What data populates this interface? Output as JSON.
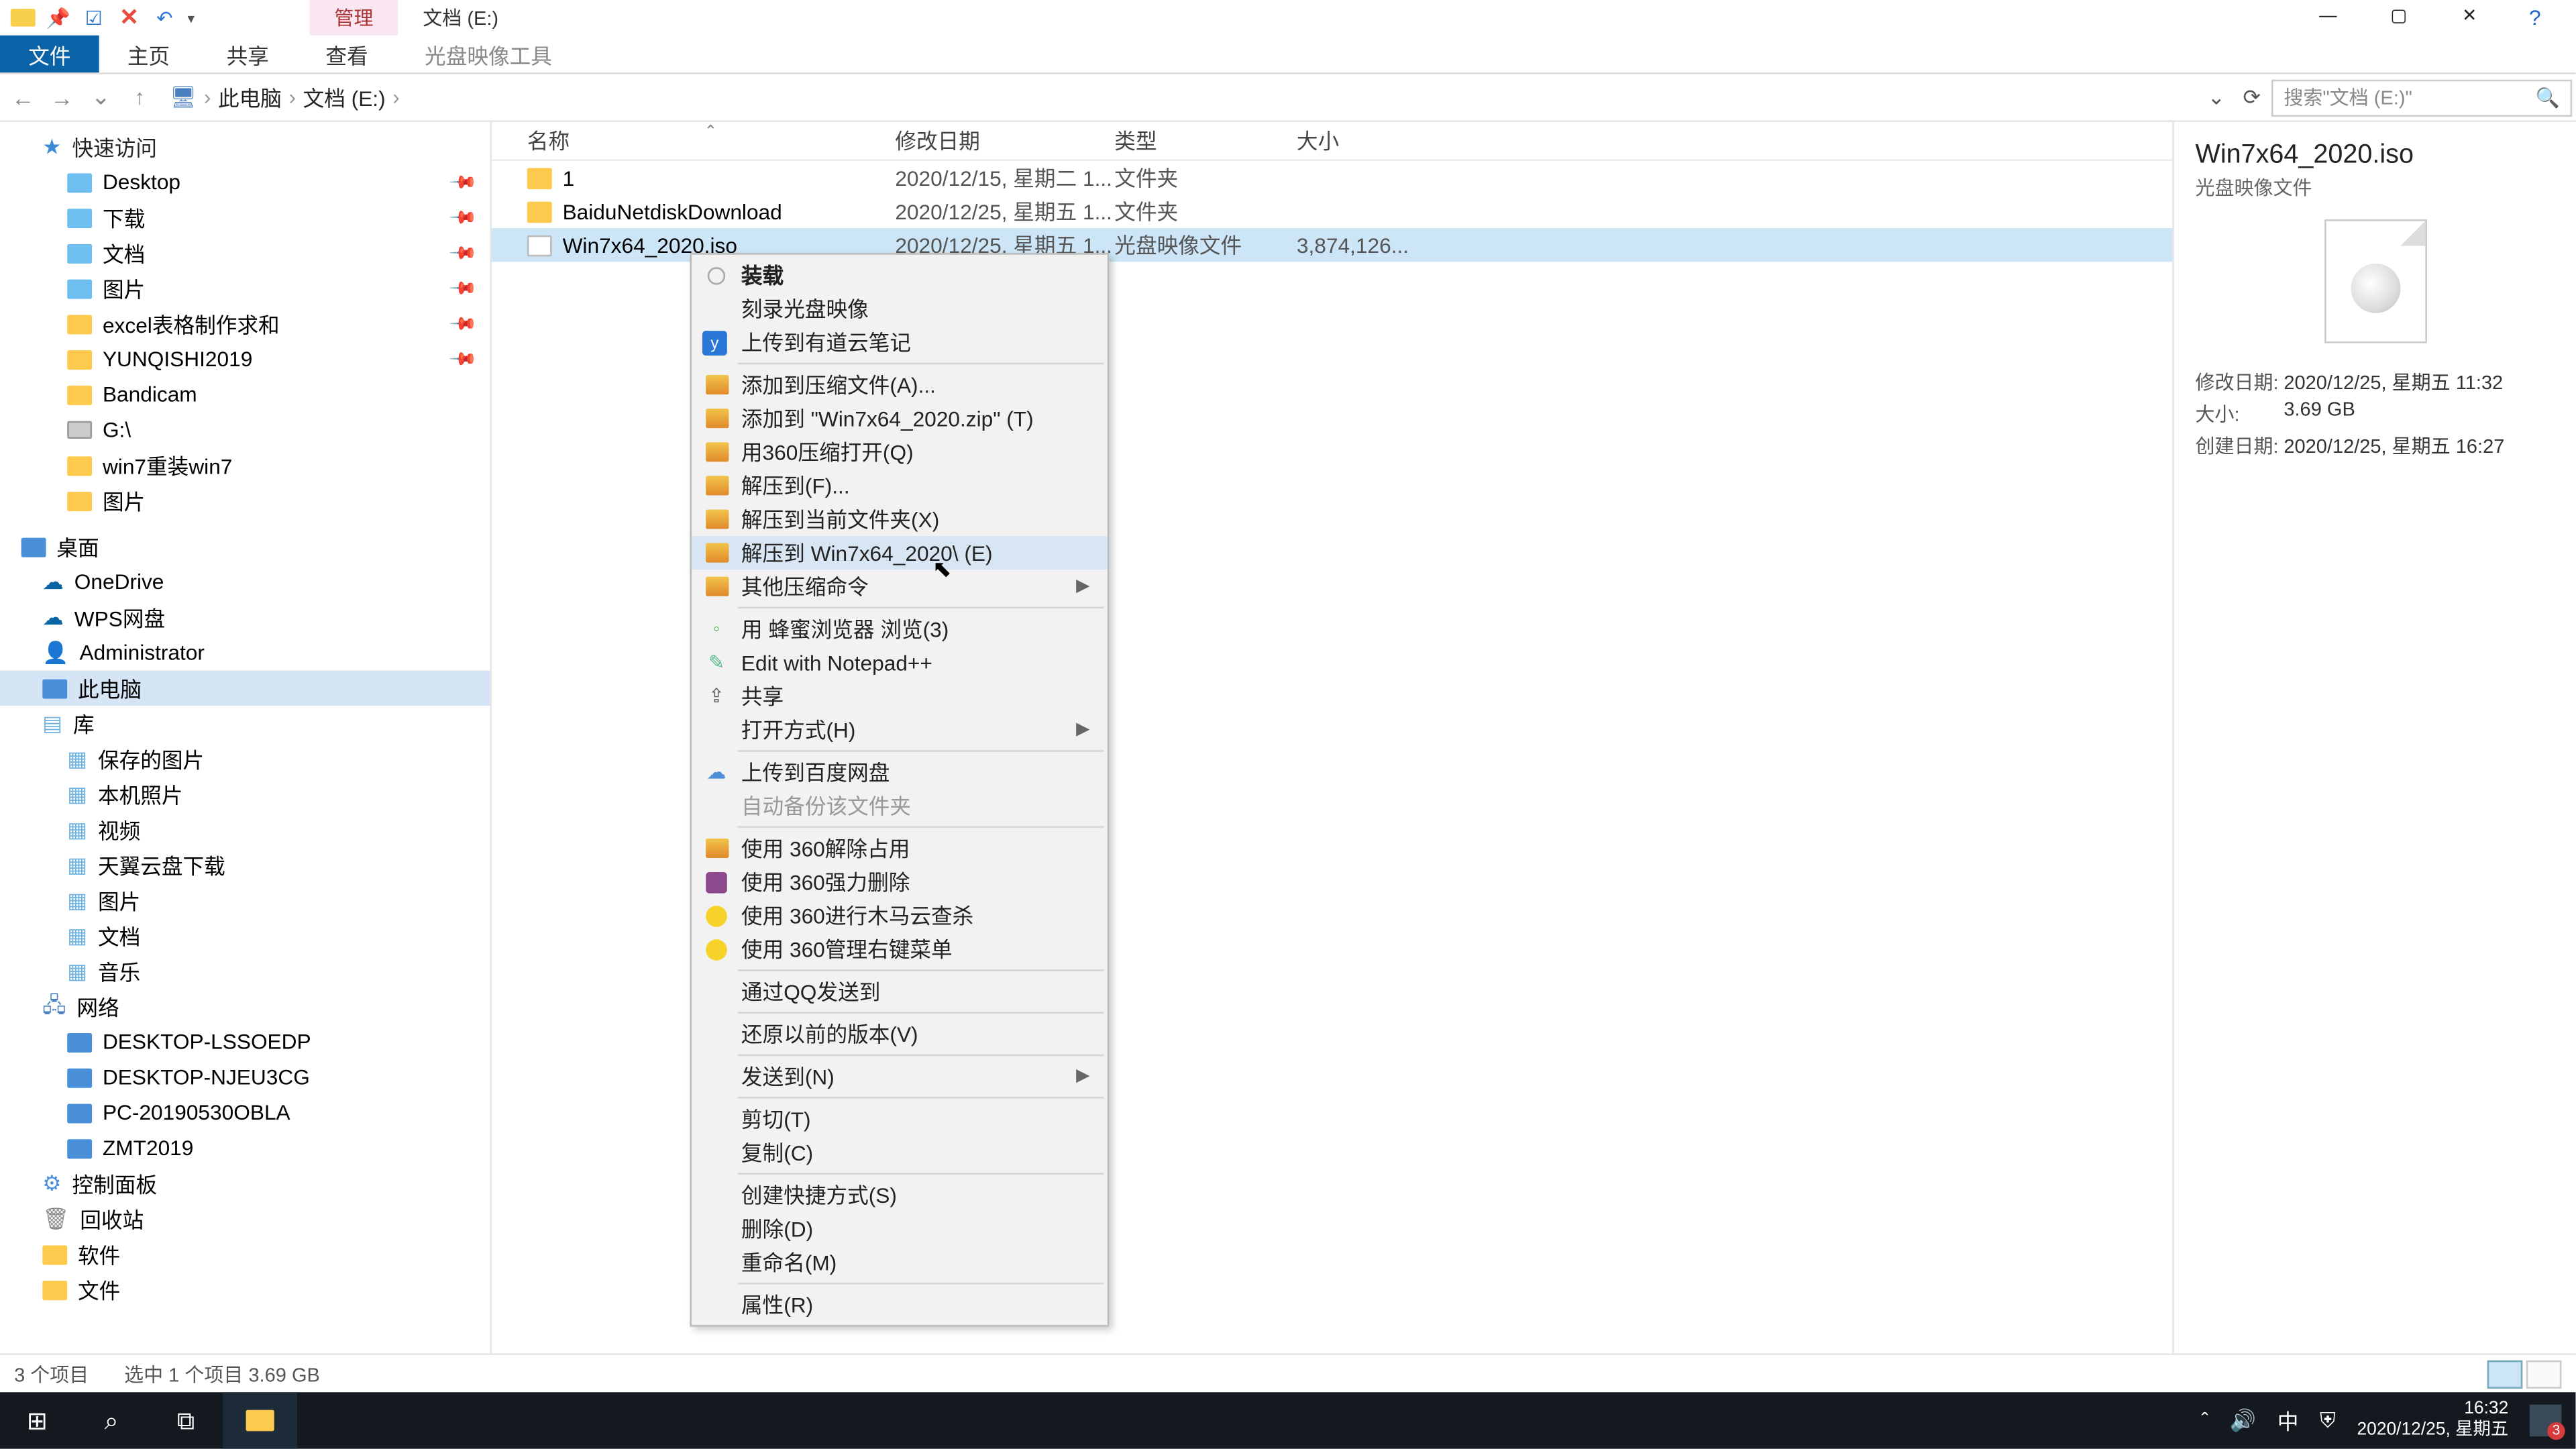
{
  "titlebar": {
    "tab_manage": "管理",
    "tab_title": "文档 (E:)"
  },
  "window": {
    "minimize": "—",
    "maximize": "▢",
    "close": "✕",
    "help": "?"
  },
  "ribbon": {
    "file": "文件",
    "home": "主页",
    "share": "共享",
    "view": "查看",
    "tool": "光盘映像工具"
  },
  "nav": {
    "back": "←",
    "fwd": "→",
    "up": "↑",
    "caret": "⌄",
    "refresh": "⟳"
  },
  "breadcrumb": {
    "root": "此电脑",
    "drive": "文档 (E:)"
  },
  "search": {
    "placeholder": "搜索\"文档 (E:)\"",
    "icon": "🔍"
  },
  "tree": {
    "quick": "快速访问",
    "items_quick": [
      "Desktop",
      "下载",
      "文档",
      "图片",
      "excel表格制作求和",
      "YUNQISHI2019",
      "Bandicam",
      "G:\\",
      "win7重装win7",
      "图片"
    ],
    "desktop_hdr": "桌面",
    "onedrive": "OneDrive",
    "wps": "WPS网盘",
    "admin": "Administrator",
    "thispc": "此电脑",
    "lib": "库",
    "lib_items": [
      "保存的图片",
      "本机照片",
      "视频",
      "天翼云盘下载",
      "图片",
      "文档",
      "音乐"
    ],
    "network": "网络",
    "net_items": [
      "DESKTOP-LSSOEDP",
      "DESKTOP-NJEU3CG",
      "PC-20190530OBLA",
      "ZMT2019"
    ],
    "cpanel": "控制面板",
    "recycle": "回收站",
    "soft": "软件",
    "docs": "文件"
  },
  "columns": {
    "name": "名称",
    "date": "修改日期",
    "type": "类型",
    "size": "大小"
  },
  "rows": [
    {
      "name": "1",
      "date": "2020/12/15, 星期二 1...",
      "type": "文件夹",
      "size": ""
    },
    {
      "name": "BaiduNetdiskDownload",
      "date": "2020/12/25, 星期五 1...",
      "type": "文件夹",
      "size": ""
    },
    {
      "name": "Win7x64_2020.iso",
      "date": "2020/12/25, 星期五 1...",
      "type": "光盘映像文件",
      "size": "3,874,126..."
    }
  ],
  "cmenu": {
    "mount": "装载",
    "burn": "刻录光盘映像",
    "youdao": "上传到有道云笔记",
    "add_archive": "添加到压缩文件(A)...",
    "add_zip": "添加到 \"Win7x64_2020.zip\" (T)",
    "open_360zip": "用360压缩打开(Q)",
    "extract_to": "解压到(F)...",
    "extract_here": "解压到当前文件夹(X)",
    "extract_folder": "解压到 Win7x64_2020\\ (E)",
    "other_zip": "其他压缩命令",
    "honey": "用 蜂蜜浏览器 浏览(3)",
    "npp": "Edit with Notepad++",
    "share": "共享",
    "open_with": "打开方式(H)",
    "baidu": "上传到百度网盘",
    "auto_backup": "自动备份该文件夹",
    "unlock360": "使用 360解除占用",
    "del360": "使用 360强力删除",
    "scan360": "使用 360进行木马云查杀",
    "menu360": "使用 360管理右键菜单",
    "qq": "通过QQ发送到",
    "restore": "还原以前的版本(V)",
    "sendto": "发送到(N)",
    "cut": "剪切(T)",
    "copy": "复制(C)",
    "shortcut": "创建快捷方式(S)",
    "delete": "删除(D)",
    "rename": "重命名(M)",
    "props": "属性(R)"
  },
  "details": {
    "title": "Win7x64_2020.iso",
    "subtitle": "光盘映像文件",
    "mod_label": "修改日期:",
    "mod_val": "2020/12/25, 星期五 11:32",
    "size_label": "大小:",
    "size_val": "3.69 GB",
    "create_label": "创建日期:",
    "create_val": "2020/12/25, 星期五 16:27"
  },
  "status": {
    "count": "3 个项目",
    "sel": "选中 1 个项目  3.69 GB"
  },
  "tray": {
    "time": "16:32",
    "date": "2020/12/25, 星期五",
    "ime": "中",
    "badge": "3"
  }
}
